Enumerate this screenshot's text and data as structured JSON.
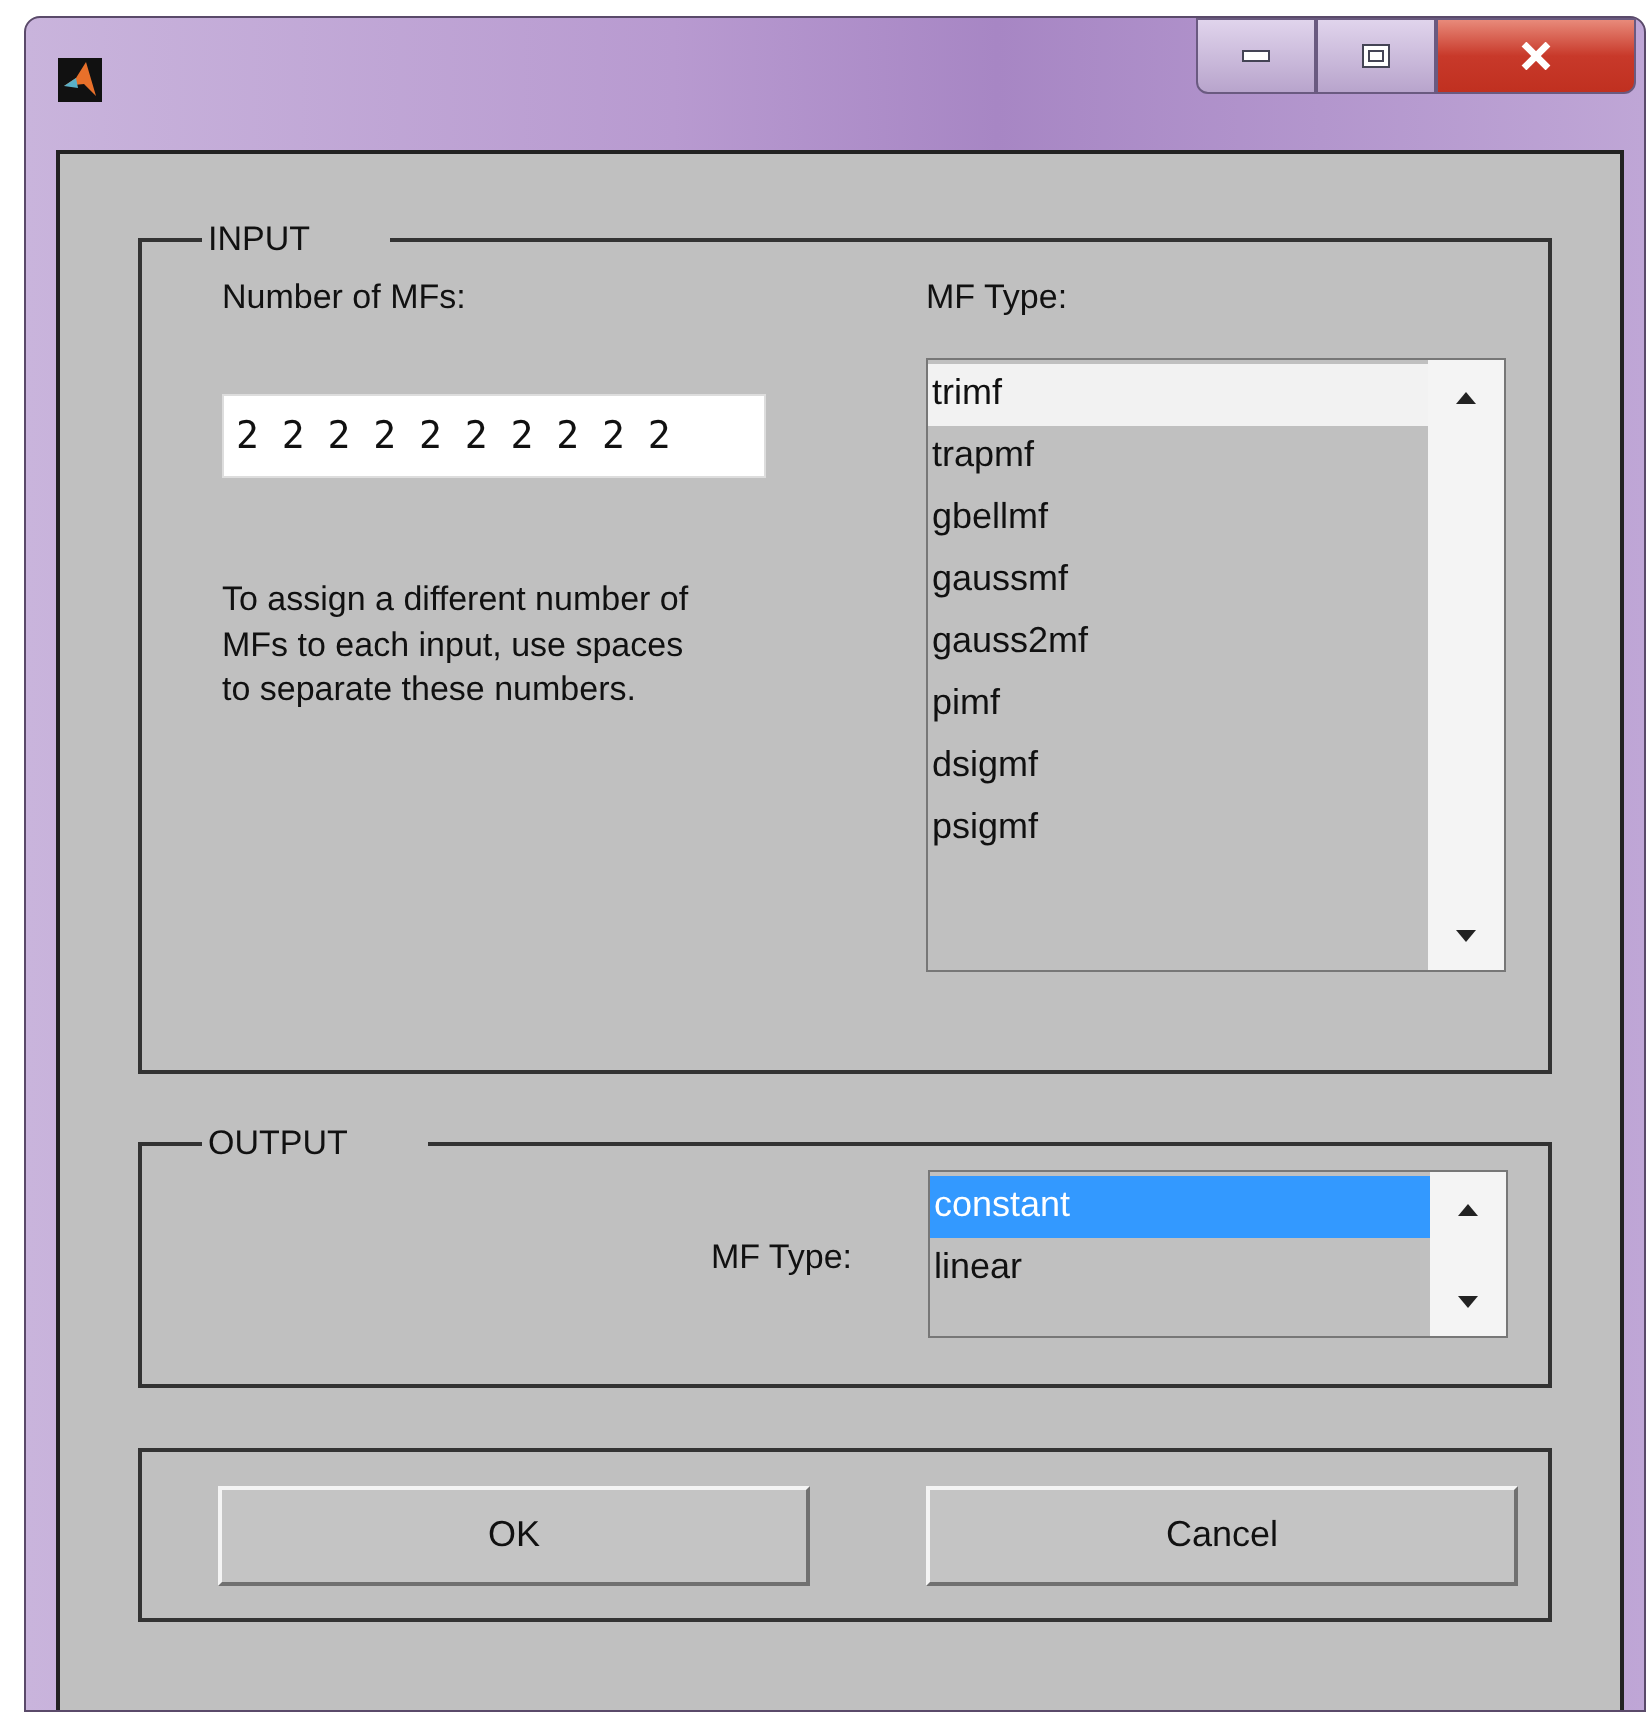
{
  "input": {
    "group_title": "INPUT",
    "count_label": "Number of MFs:",
    "count_value": "2 2 2 2 2 2 2 2 2 2",
    "hint": "To assign a different number of MFs to each input, use spaces to separate these numbers.",
    "type_label": "MF Type:",
    "types_focused": false,
    "types": [
      {
        "label": "trimf",
        "selected": true
      },
      {
        "label": "trapmf",
        "selected": false
      },
      {
        "label": "gbellmf",
        "selected": false
      },
      {
        "label": "gaussmf",
        "selected": false
      },
      {
        "label": "gauss2mf",
        "selected": false
      },
      {
        "label": "pimf",
        "selected": false
      },
      {
        "label": "dsigmf",
        "selected": false
      },
      {
        "label": "psigmf",
        "selected": false
      }
    ]
  },
  "output": {
    "group_title": "OUTPUT",
    "type_label": "MF Type:",
    "types_focused": true,
    "types": [
      {
        "label": "constant",
        "selected": true
      },
      {
        "label": "linear",
        "selected": false
      }
    ]
  },
  "buttons": [
    "OK",
    "Cancel"
  ]
}
